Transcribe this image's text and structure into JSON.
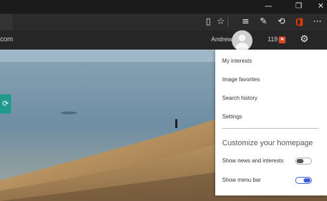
{
  "window": {
    "minimize_icon": "minimize-icon",
    "maximize_icon": "restore-icon",
    "close_icon": "close-icon"
  },
  "toolbar": {
    "icons": [
      "reading-view-icon",
      "favorite-star-icon",
      "hub-icon",
      "web-note-icon",
      "share-icon",
      "office-icon",
      "more-icon"
    ]
  },
  "page": {
    "url_fragment": "com",
    "user_name": "Andrew",
    "points": "119"
  },
  "menu": {
    "items": [
      "My interests",
      "Image favorites",
      "Search history",
      "Settings"
    ],
    "customize_title": "Customize your homepage",
    "toggles": [
      {
        "label": "Show news and interests",
        "state": "off"
      },
      {
        "label": "Show menu bar",
        "state": "on"
      }
    ]
  },
  "colors": {
    "accent_toggle": "#3a5ad8",
    "teal_tab": "#1f9a8c",
    "office_icon": "#d83b01",
    "rewards_badge": "#d9472b"
  }
}
